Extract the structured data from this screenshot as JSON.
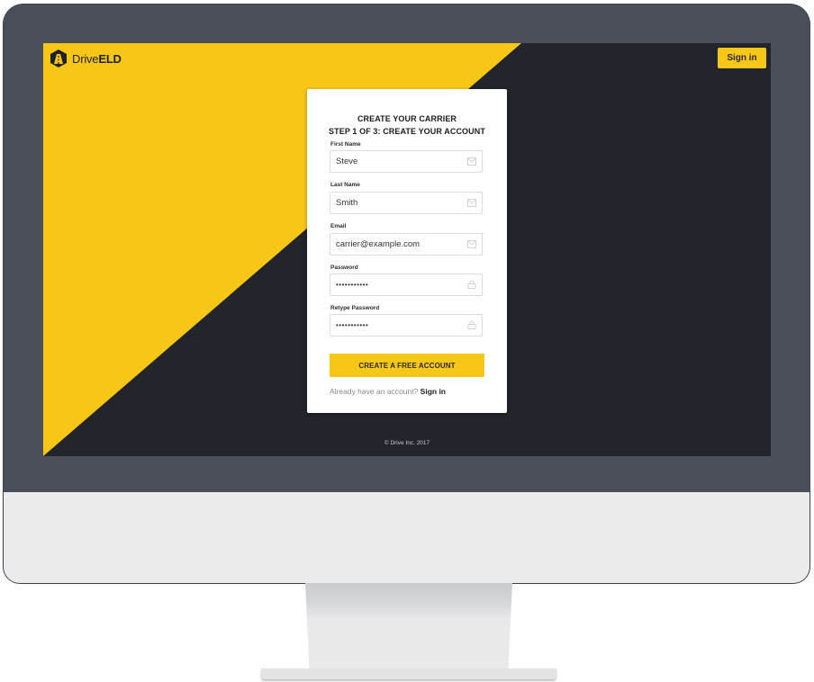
{
  "app": {
    "brand_prefix": "Drive",
    "brand_suffix": "ELD",
    "header_signin_label": "Sign in",
    "footer_text": "© Drive Inc. 2017"
  },
  "form": {
    "title_line1": "CREATE YOUR CARRIER",
    "title_line2": "STEP 1 OF 3: CREATE YOUR ACCOUNT",
    "fields": [
      {
        "label": "First Name",
        "value": "Steve",
        "icon": "envelope-icon"
      },
      {
        "label": "Last Name",
        "value": "Smith",
        "icon": "envelope-icon"
      },
      {
        "label": "Email",
        "value": "carrier@example.com",
        "icon": "envelope-icon"
      },
      {
        "label": "Password",
        "value": "•••••••••••",
        "icon": "lock-icon"
      },
      {
        "label": "Retype Password",
        "value": "•••••••••••",
        "icon": "lock-icon"
      }
    ],
    "submit_label": "CREATE A FREE ACCOUNT",
    "already_text": "Already have an account?",
    "signin_link_label": "Sign in"
  },
  "colors": {
    "accent_yellow": "#F6C716",
    "screen_dark": "#22252C",
    "bezel": "#4A4F5A"
  }
}
